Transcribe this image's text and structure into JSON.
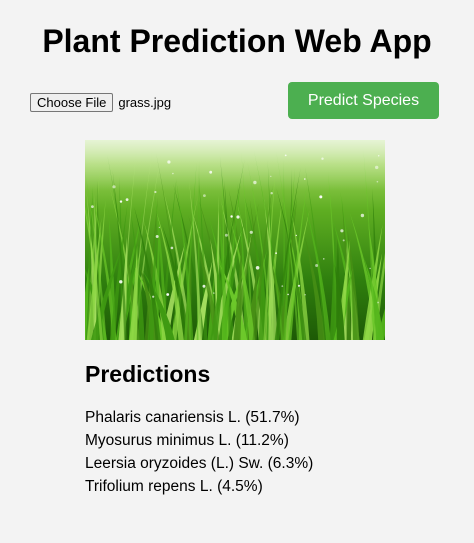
{
  "app": {
    "title": "Plant Prediction Web App"
  },
  "upload": {
    "choose_label": "Choose File",
    "file_name": "grass.jpg"
  },
  "actions": {
    "predict_label": "Predict Species",
    "accent_color": "#4caf50"
  },
  "preview": {
    "alt": "grass.jpg preview"
  },
  "predictions": {
    "heading": "Predictions",
    "items": [
      "Phalaris canariensis L. (51.7%)",
      "Myosurus minimus L. (11.2%)",
      "Leersia oryzoides (L.) Sw. (6.3%)",
      "Trifolium repens L. (4.5%)"
    ]
  }
}
